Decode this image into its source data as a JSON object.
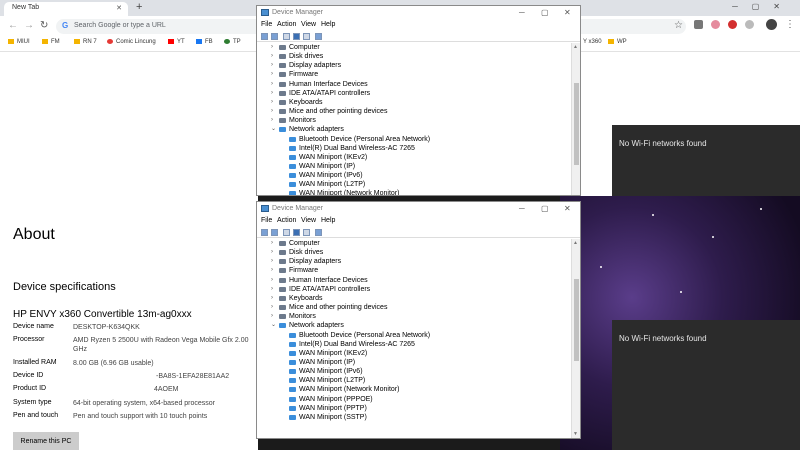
{
  "chrome": {
    "tab_title": "New Tab",
    "new_tab_glyph": "+",
    "omnibox_placeholder": "Search Google or type a URL",
    "bookmarks": [
      "MIUI",
      "FM",
      "RN 7",
      "Comic Lincung",
      "YT",
      "FB",
      "TP"
    ],
    "bookmark_extra": [
      "Y x360",
      "WP"
    ]
  },
  "wifi": {
    "top_message": "No Wi-Fi networks found",
    "bottom_message": "No Wi-Fi networks found"
  },
  "about": {
    "title": "About",
    "specs_title": "Device specifications",
    "device_model": "HP ENVY x360 Convertible 13m-ag0xxx",
    "rows": [
      {
        "label": "Device name",
        "value": "DESKTOP-K634QKK"
      },
      {
        "label": "Processor",
        "value": "AMD Ryzen 5 2500U with Radeon Vega Mobile Gfx 2.00 GHz"
      },
      {
        "label": "Installed RAM",
        "value": "8.00 GB (6.96 GB usable)"
      },
      {
        "label": "Device ID",
        "value": "-BA8S-1EFA28E81AA2"
      },
      {
        "label": "Product ID",
        "value": "4AOEM"
      },
      {
        "label": "System type",
        "value": "64-bit operating system, x64-based processor"
      },
      {
        "label": "Pen and touch",
        "value": "Pen and touch support with 10 touch points"
      }
    ],
    "rename_button": "Rename this PC"
  },
  "devmgr": {
    "title": "Device Manager",
    "menu": [
      "File",
      "Action",
      "View",
      "Help"
    ],
    "categories": [
      "Computer",
      "Disk drives",
      "Display adapters",
      "Firmware",
      "Human Interface Devices",
      "IDE ATA/ATAPI controllers",
      "Keyboards",
      "Mice and other pointing devices",
      "Monitors",
      "Network adapters"
    ],
    "network_adapters": [
      "Bluetooth Device (Personal Area Network)",
      "Intel(R) Dual Band Wireless-AC 7265",
      "WAN Miniport (IKEv2)",
      "WAN Miniport (IP)",
      "WAN Miniport (IPv6)",
      "WAN Miniport (L2TP)",
      "WAN Miniport (Network Monitor)",
      "WAN Miniport (PPPOE)",
      "WAN Miniport (PPTP)",
      "WAN Miniport (SSTP)"
    ]
  }
}
